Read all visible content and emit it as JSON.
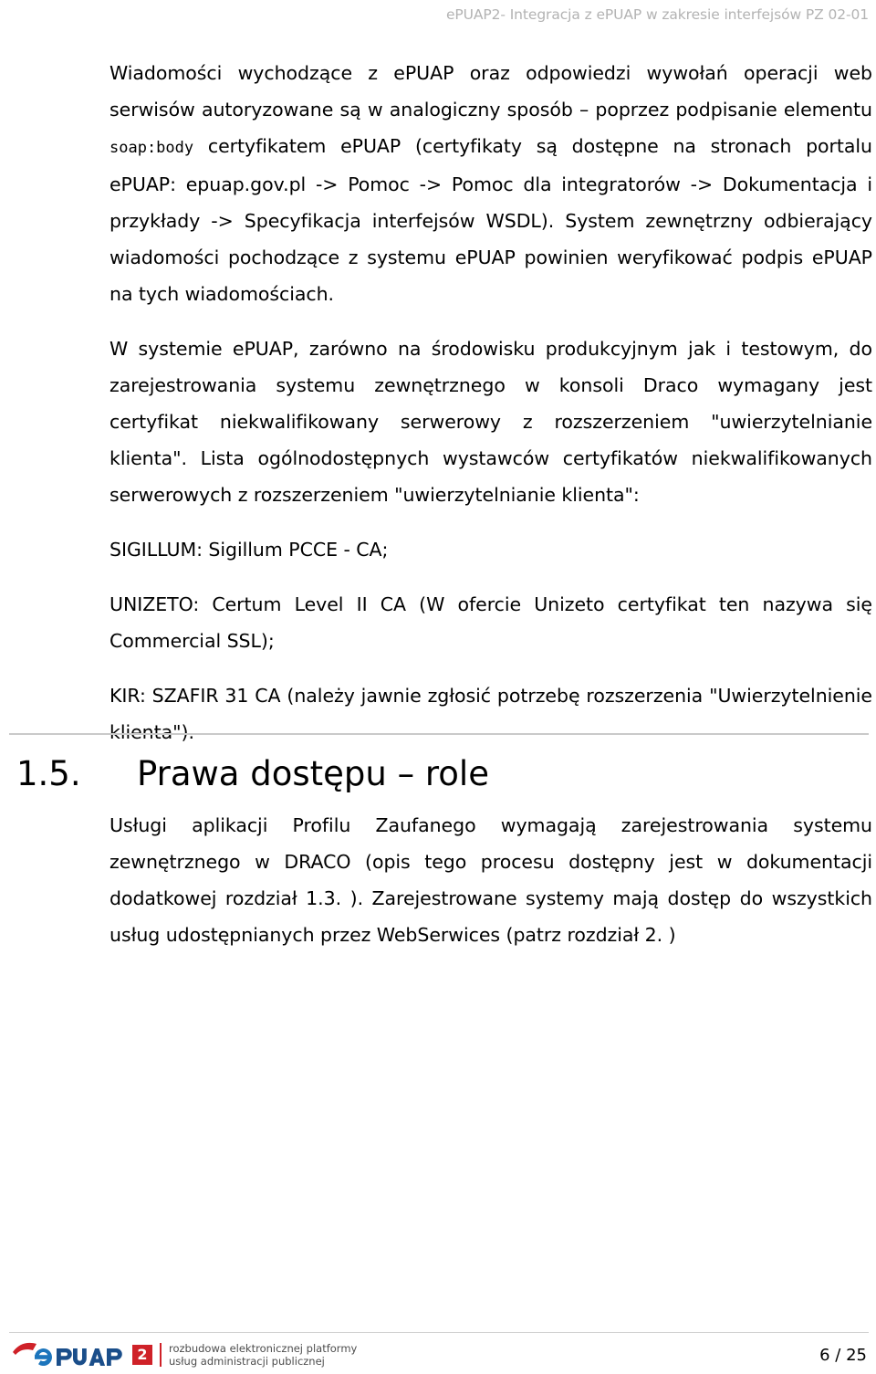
{
  "header": {
    "running_title": "ePUAP2- Integracja z ePUAP w zakresie interfejsów PZ 02-01",
    "color": "#b3b3b3"
  },
  "content": {
    "paragraph_1_part_a": "Wiadomości wychodzące z ePUAP oraz odpowiedzi wywołań operacji web serwisów autoryzowane są w analogiczny sposób – poprzez podpisanie elementu ",
    "paragraph_1_code": "soap:body",
    "paragraph_1_part_b": " certyfikatem ePUAP (certyfikaty są dostępne na stronach portalu ePUAP: epuap.gov.pl -> Pomoc -> Pomoc dla integratorów -> Dokumentacja i przykłady -> Specyfikacja interfejsów WSDL). System zewnętrzny odbierający wiadomości pochodzące z systemu ePUAP powinien weryfikować podpis ePUAP na tych wiadomościach.",
    "paragraph_2": "W systemie ePUAP, zarówno na środowisku produkcyjnym jak i testowym, do zarejestrowania systemu zewnętrznego w konsoli Draco wymagany jest certyfikat niekwalifikowany serwerowy z rozszerzeniem \"uwierzytelnianie klienta\". Lista ogólnodostępnych wystawców certyfikatów niekwalifikowanych serwerowych z rozszerzeniem \"uwierzytelnianie klienta\":",
    "ca_list": [
      "SIGILLUM: Sigillum PCCE - CA;",
      "UNIZETO: Certum Level II CA (W ofercie Unizeto certyfikat ten nazywa się Commercial SSL);",
      "KIR: SZAFIR 31 CA (należy jawnie zgłosić potrzebę rozszerzenia \"Uwierzytelnienie klienta\")."
    ]
  },
  "section": {
    "number": "1.5.",
    "title": "Prawa dostępu – role",
    "paragraph": "Usługi aplikacji Profilu Zaufanego wymagają zarejestrowania systemu zewnętrznego w DRACO (opis tego procesu dostępny jest w dokumentacji dodatkowej rozdział 1.3. ). Zarejestrowane systemy mają dostęp do wszystkich usług udostępnianych przez WebSerwices (patrz rozdział 2. )"
  },
  "footer": {
    "logo_text": "ePUAP",
    "logo_badge": "2",
    "tagline_line_1": "rozbudowa elektronicznej platformy",
    "tagline_line_2": "usług administracji publicznej",
    "page_number": "6 / 25",
    "logo_blue": "#1a4e8a",
    "logo_light_blue": "#1c75bc",
    "logo_red": "#cf2128"
  }
}
